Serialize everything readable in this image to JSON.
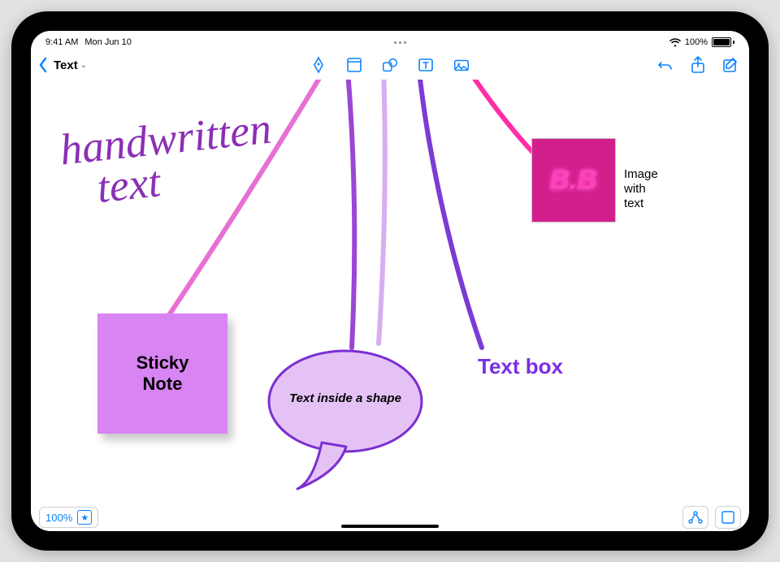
{
  "status": {
    "time": "9:41 AM",
    "date": "Mon Jun 10",
    "battery": "100%"
  },
  "header": {
    "title": "Text"
  },
  "canvas": {
    "handwritten": "handwritten\n   text",
    "sticky": "Sticky\nNote",
    "shape_text": "Text inside a shape",
    "textbox": "Text box",
    "image_inner": "B.B",
    "image_caption": "Image\nwith\ntext"
  },
  "footer": {
    "zoom": "100%"
  },
  "colors": {
    "accent": "#0a84ff",
    "handwriting": "#8b2fb5",
    "sticky_bg": "#d884f2",
    "bubble_fill": "#e5c2f5",
    "bubble_stroke": "#7b2fd0",
    "textbox_color": "#7a2ee6",
    "neon_pink": "#ff3fbb"
  }
}
